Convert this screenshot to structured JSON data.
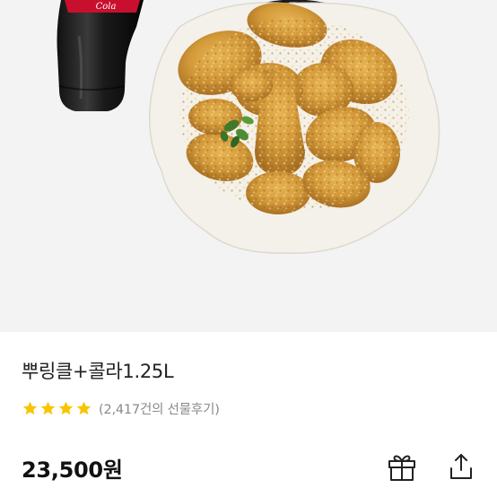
{
  "product": {
    "title": "뿌링클+콜라1.25L",
    "rating": 4,
    "rating_max": 5,
    "review_count_text": "(2,417건의 선물후기)",
    "price": "23,500원",
    "image_label": "Coca-Cola"
  },
  "actions": {
    "gift": "gift-icon",
    "share": "share-icon"
  },
  "colors": {
    "star": "#F7C500",
    "image_background": "#F3F3F3",
    "text_primary": "#222222",
    "text_secondary": "#8A8A8A"
  }
}
